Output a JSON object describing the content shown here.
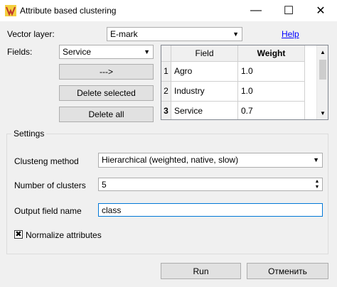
{
  "window": {
    "title": "Attribute based clustering",
    "minimize": "—",
    "maximize": "☐",
    "close": "✕"
  },
  "vector_layer": {
    "label": "Vector layer:",
    "value": "E-mark"
  },
  "help_link": "Help",
  "fields": {
    "label": "Fields:",
    "value": "Service"
  },
  "buttons": {
    "add": "--->",
    "delete_selected": "Delete selected",
    "delete_all": "Delete all",
    "run": "Run",
    "cancel": "Отменить"
  },
  "table": {
    "columns": [
      "Field",
      "Weight"
    ],
    "rows": [
      {
        "num": "1",
        "field": "Agro",
        "weight": "1.0"
      },
      {
        "num": "2",
        "field": "Industry",
        "weight": "1.0"
      },
      {
        "num": "3",
        "field": "Service",
        "weight": "0.7"
      }
    ]
  },
  "settings": {
    "title": "Settings",
    "method_label": "Clusteng method",
    "method_value": "Hierarchical (weighted, native, slow)",
    "clusters_label": "Number of clusters",
    "clusters_value": "5",
    "output_label": "Output field name",
    "output_value": "class",
    "normalize_label": "Normalize attributes",
    "normalize_checked": true
  },
  "colors": {
    "accent": "#0078d7",
    "link": "#0000ff"
  }
}
